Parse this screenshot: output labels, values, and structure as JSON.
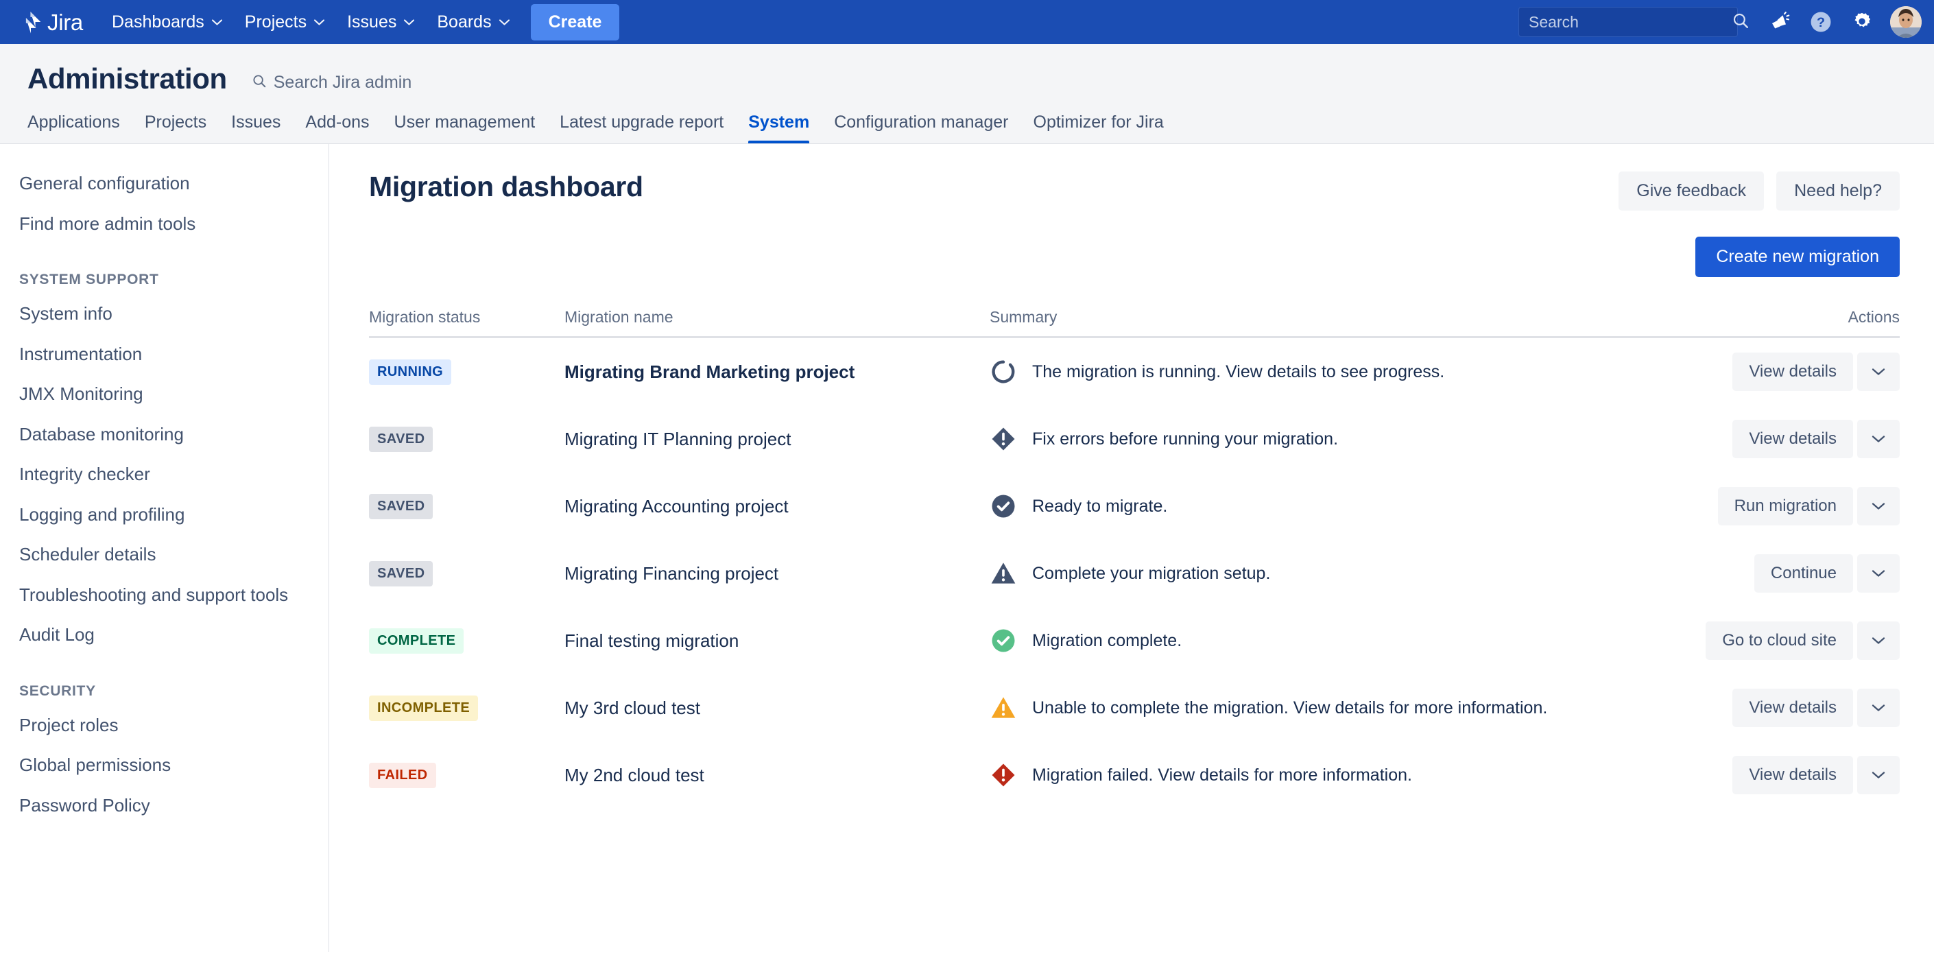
{
  "topnav": {
    "brand": "Jira",
    "items": [
      {
        "label": "Dashboards",
        "caret": "⌄"
      },
      {
        "label": "Projects",
        "caret": "⌄"
      },
      {
        "label": "Issues",
        "caret": "⌄"
      },
      {
        "label": "Boards",
        "caret": "⌄"
      }
    ],
    "create_label": "Create",
    "search_placeholder": "Search",
    "search_value": "",
    "icons": [
      "megaphone-icon",
      "help-icon",
      "settings-gear-icon",
      "avatar"
    ],
    "bg_color": "#1b4db3",
    "create_color": "#4c87ef"
  },
  "admin": {
    "title": "Administration",
    "search_label": "Search Jira admin",
    "tabs": [
      {
        "label": "Applications",
        "active": false
      },
      {
        "label": "Projects",
        "active": false
      },
      {
        "label": "Issues",
        "active": false
      },
      {
        "label": "Add-ons",
        "active": false
      },
      {
        "label": "User management",
        "active": false
      },
      {
        "label": "Latest upgrade report",
        "active": false
      },
      {
        "label": "System",
        "active": true
      },
      {
        "label": "Configuration manager",
        "active": false
      },
      {
        "label": "Optimizer for Jira",
        "active": false
      }
    ],
    "active_color": "#0052cc"
  },
  "sidebar": {
    "groups": [
      {
        "heading": null,
        "items": [
          {
            "label": "General configuration"
          },
          {
            "label": "Find more admin tools"
          }
        ]
      },
      {
        "heading": "SYSTEM SUPPORT",
        "items": [
          {
            "label": "System info"
          },
          {
            "label": "Instrumentation"
          },
          {
            "label": "JMX Monitoring"
          },
          {
            "label": "Database monitoring"
          },
          {
            "label": "Integrity checker"
          },
          {
            "label": "Logging and profiling"
          },
          {
            "label": "Scheduler details"
          },
          {
            "label": "Troubleshooting and support tools"
          },
          {
            "label": "Audit Log"
          }
        ]
      },
      {
        "heading": "SECURITY",
        "items": [
          {
            "label": "Project roles"
          },
          {
            "label": "Global permissions"
          },
          {
            "label": "Password Policy"
          }
        ]
      }
    ]
  },
  "main": {
    "page_title": "Migration dashboard",
    "give_feedback_label": "Give feedback",
    "need_help_label": "Need help?",
    "create_migration_label": "Create new migration",
    "table": {
      "columns": [
        "Migration status",
        "Migration name",
        "Summary",
        "Actions"
      ],
      "rows": [
        {
          "status": "RUNNING",
          "status_bg": "#deebff",
          "status_fg": "#0747a6",
          "name": "Migrating Brand Marketing project",
          "name_bold": true,
          "icon": "spinner-icon",
          "icon_color": "#42526e",
          "summary": "The migration is running. View details to see progress.",
          "action_label": "View details",
          "caret": "⌄"
        },
        {
          "status": "SAVED",
          "status_bg": "#dfe1e6",
          "status_fg": "#42526e",
          "name": "Migrating IT Planning project",
          "name_bold": false,
          "icon": "error-diamond-icon",
          "icon_color": "#42526e",
          "summary": "Fix errors before running your migration.",
          "action_label": "View details",
          "caret": "⌄"
        },
        {
          "status": "SAVED",
          "status_bg": "#dfe1e6",
          "status_fg": "#42526e",
          "name": "Migrating Accounting project",
          "name_bold": false,
          "icon": "check-circle-icon",
          "icon_color": "#42526e",
          "summary": "Ready to migrate.",
          "action_label": "Run migration",
          "caret": "⌄"
        },
        {
          "status": "SAVED",
          "status_bg": "#dfe1e6",
          "status_fg": "#42526e",
          "name": "Migrating Financing project",
          "name_bold": false,
          "icon": "warning-triangle-icon",
          "icon_color": "#42526e",
          "summary": "Complete your migration setup.",
          "action_label": "Continue",
          "caret": "⌄"
        },
        {
          "status": "COMPLETE",
          "status_bg": "#e3fcef",
          "status_fg": "#006644",
          "name": "Final testing migration",
          "name_bold": false,
          "icon": "check-circle-icon",
          "icon_color": "#57c088",
          "summary": "Migration complete.",
          "action_label": "Go to cloud site",
          "caret": "⌄"
        },
        {
          "status": "INCOMPLETE",
          "status_bg": "#fcf3cd",
          "status_fg": "#7f6000",
          "name": "My 3rd cloud test",
          "name_bold": false,
          "icon": "warning-triangle-icon",
          "icon_color": "#f5a524",
          "summary": "Unable to complete the migration. View details for more information.",
          "action_label": "View details",
          "caret": "⌄"
        },
        {
          "status": "FAILED",
          "status_bg": "#fcebe8",
          "status_fg": "#bf2600",
          "name": "My 2nd cloud test",
          "name_bold": false,
          "icon": "error-diamond-icon",
          "icon_color": "#bb2a18",
          "summary": "Migration failed. View details for more information.",
          "action_label": "View details",
          "caret": "⌄"
        }
      ]
    }
  }
}
